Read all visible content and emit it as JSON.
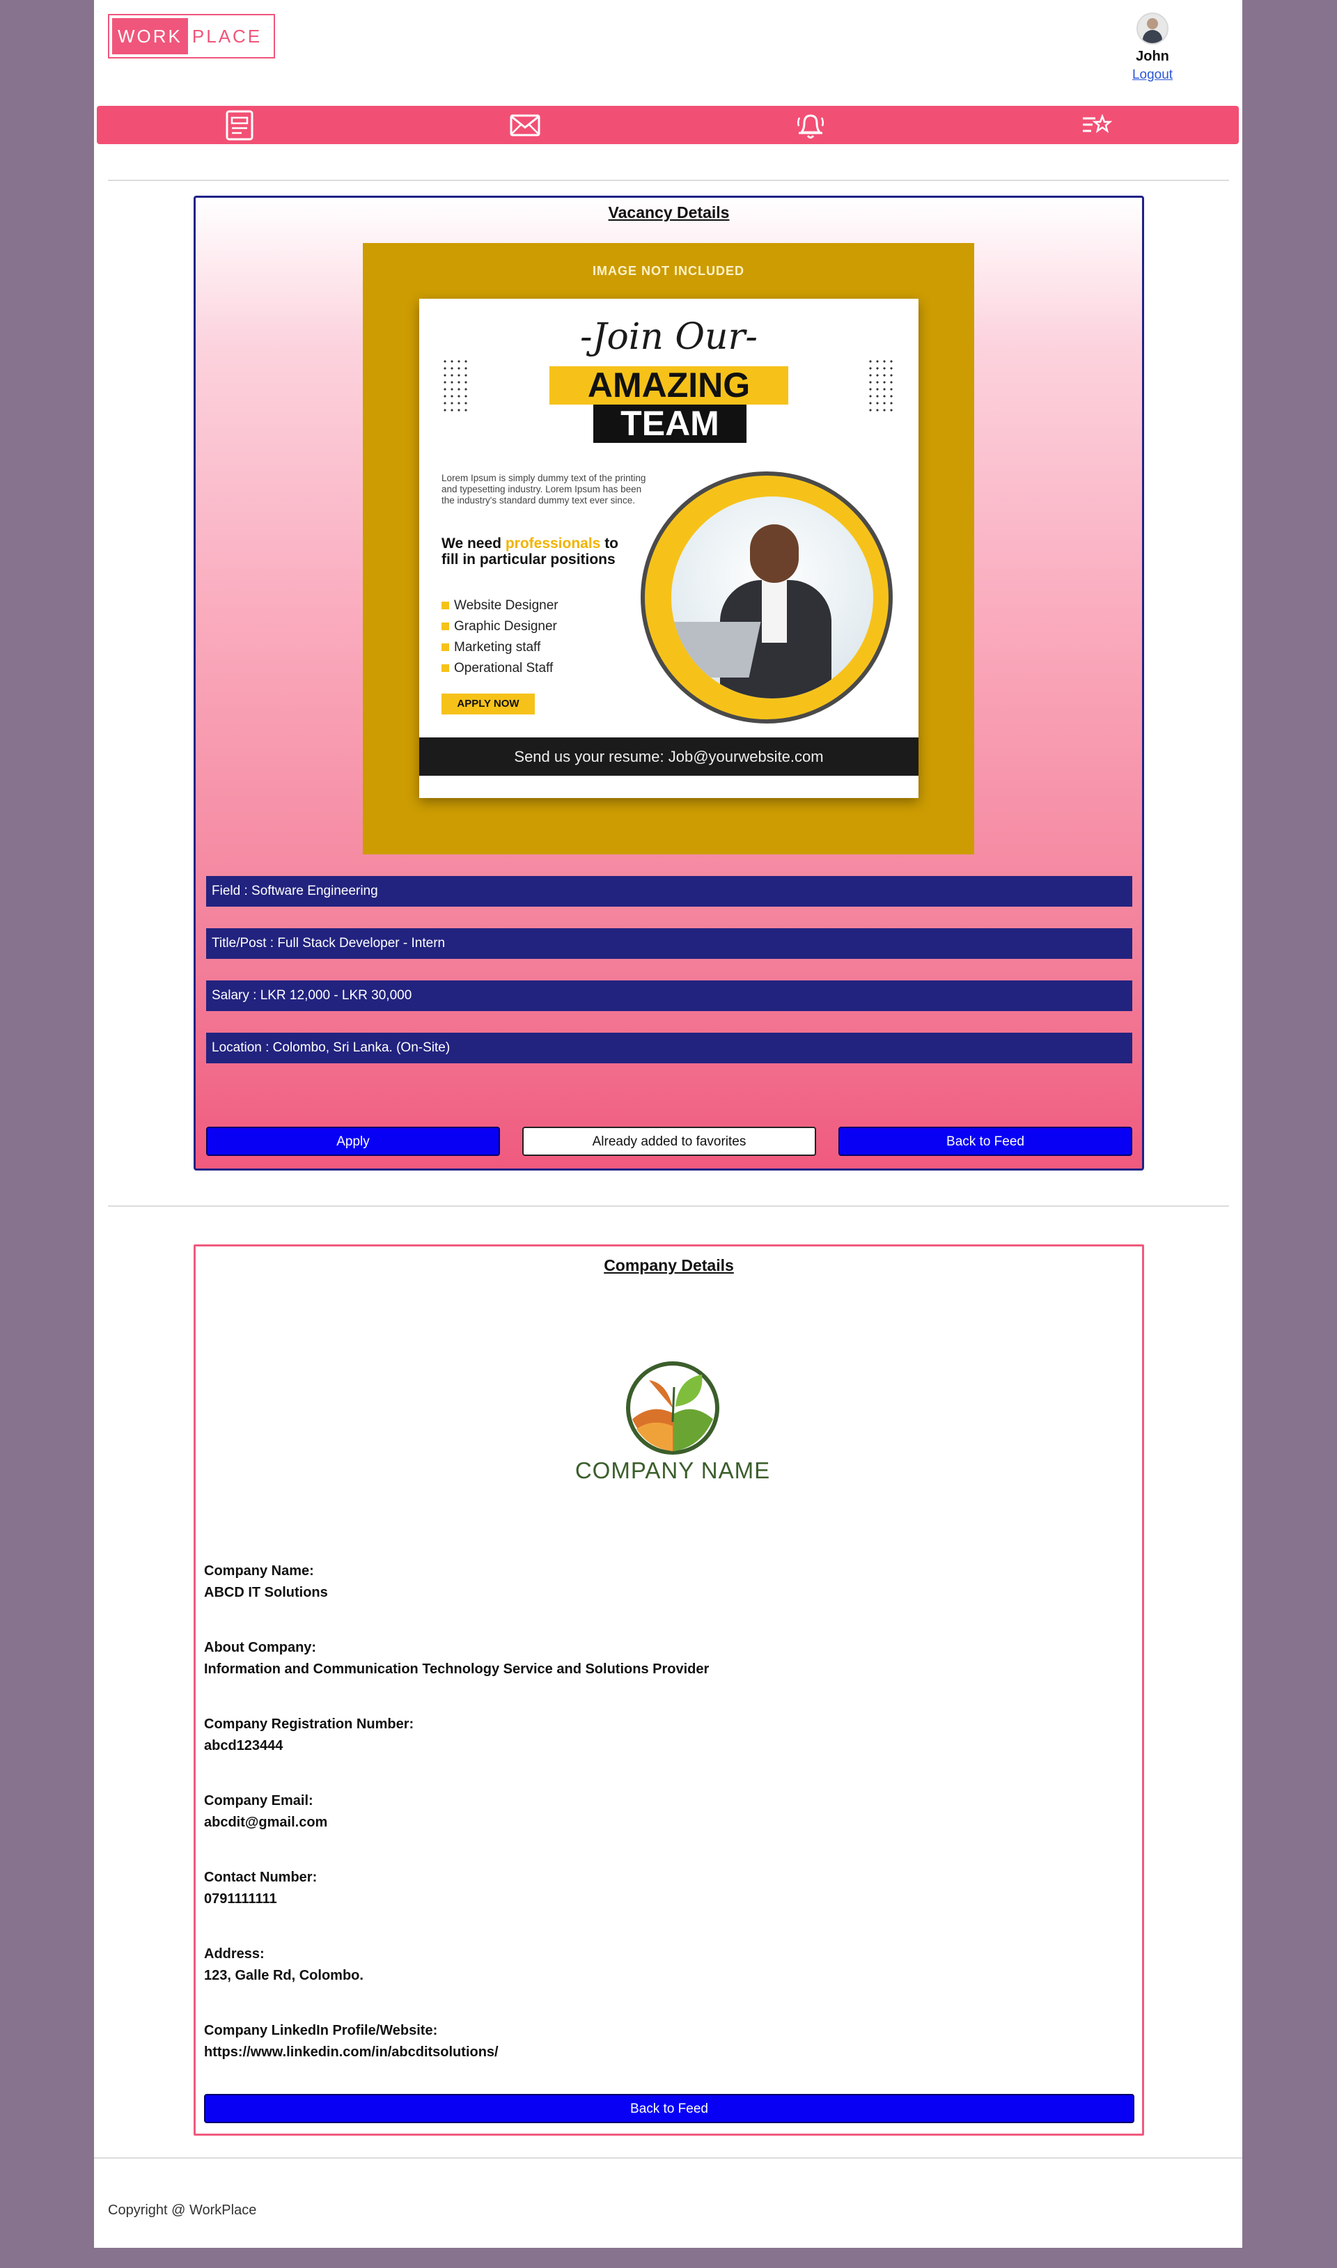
{
  "header": {
    "logo_part1": "WORK",
    "logo_part2": "PLACE",
    "user_name": "John",
    "logout_label": "Logout"
  },
  "nav": {
    "icons": [
      "feed-icon",
      "mail-icon",
      "notification-bell-icon",
      "favorites-list-icon"
    ]
  },
  "vacancy": {
    "title": "Vacancy Details",
    "poster": {
      "notice": "IMAGE NOT INCLUDED",
      "join": "-Join Our-",
      "amazing": "AMAZING",
      "team": "TEAM",
      "lorem": "Lorem Ipsum is simply dummy text of the printing and typesetting industry. Lorem Ipsum has been the industry's standard dummy text ever since.",
      "need_prefix": "We need ",
      "need_highlight": "professionals",
      "need_suffix": " to fill in particular positions",
      "roles": [
        "Website Designer",
        "Graphic Designer",
        "Marketing staff",
        "Operational Staff"
      ],
      "apply_now": "APPLY NOW",
      "resume": "Send us your resume: Job@yourwebsite.com"
    },
    "field": "Field : Software Engineering",
    "title_post": "Title/Post : Full Stack Developer - Intern",
    "salary": "Salary : LKR 12,000 - LKR 30,000",
    "location": "Location : Colombo, Sri Lanka. (On-Site)",
    "buttons": {
      "apply": "Apply",
      "favorites": "Already added to favorites",
      "back": "Back to Feed"
    }
  },
  "company": {
    "title": "Company Details",
    "logo_text": "COMPANY NAME",
    "fields": [
      {
        "label": "Company Name:",
        "value": "ABCD IT Solutions"
      },
      {
        "label": "About Company:",
        "value": "Information and Communication Technology Service and Solutions Provider"
      },
      {
        "label": "Company Registration Number:",
        "value": "abcd123444"
      },
      {
        "label": "Company Email:",
        "value": "abcdit@gmail.com"
      },
      {
        "label": "Contact Number:",
        "value": "0791111111"
      },
      {
        "label": "Address:",
        "value": "123, Galle Rd, Colombo."
      },
      {
        "label": "Company LinkedIn Profile/Website:",
        "value": "https://www.linkedin.com/in/abcditsolutions/"
      }
    ],
    "back_button": "Back to Feed"
  },
  "footer": {
    "copyright": "Copyright @ WorkPlace"
  },
  "colors": {
    "page_bg": "#87738e",
    "brand_pink": "#f24f74",
    "navy": "#22237f",
    "button_blue": "#0800f5"
  }
}
